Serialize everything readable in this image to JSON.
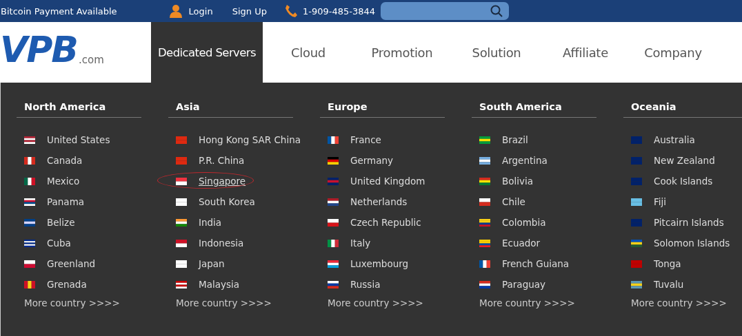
{
  "top_bar": {
    "notice": "Bitcoin Payment Available",
    "login": "Login",
    "signup": "Sign Up",
    "phone": "1-909-485-3844"
  },
  "logo": {
    "text": "VPB",
    "suffix": ".com"
  },
  "nav": [
    {
      "label": "Dedicated Servers",
      "selected": true
    },
    {
      "label": "Cloud",
      "selected": false
    },
    {
      "label": "Promotion",
      "selected": false
    },
    {
      "label": "Solution",
      "selected": false
    },
    {
      "label": "Affiliate",
      "selected": false
    },
    {
      "label": "Company",
      "selected": false
    }
  ],
  "regions": [
    {
      "title": "North America",
      "more": "More country >>>>",
      "countries": [
        {
          "name": "United States",
          "highlighted": false
        },
        {
          "name": "Canada",
          "highlighted": false
        },
        {
          "name": "Mexico",
          "highlighted": false
        },
        {
          "name": "Panama",
          "highlighted": false
        },
        {
          "name": "Belize",
          "highlighted": false
        },
        {
          "name": "Cuba",
          "highlighted": false
        },
        {
          "name": "Greenland",
          "highlighted": false
        },
        {
          "name": "Grenada",
          "highlighted": false
        }
      ]
    },
    {
      "title": "Asia",
      "more": "More country >>>>",
      "countries": [
        {
          "name": "Hong Kong SAR China",
          "highlighted": false
        },
        {
          "name": "P.R. China",
          "highlighted": false
        },
        {
          "name": "Singapore",
          "highlighted": true
        },
        {
          "name": "South Korea",
          "highlighted": false
        },
        {
          "name": "India",
          "highlighted": false
        },
        {
          "name": "Indonesia",
          "highlighted": false
        },
        {
          "name": "Japan",
          "highlighted": false
        },
        {
          "name": "Malaysia",
          "highlighted": false
        }
      ]
    },
    {
      "title": "Europe",
      "more": "More country >>>>",
      "countries": [
        {
          "name": "France",
          "highlighted": false
        },
        {
          "name": "Germany",
          "highlighted": false
        },
        {
          "name": "United Kingdom",
          "highlighted": false
        },
        {
          "name": "Netherlands",
          "highlighted": false
        },
        {
          "name": "Czech Republic",
          "highlighted": false
        },
        {
          "name": "Italy",
          "highlighted": false
        },
        {
          "name": "Luxembourg",
          "highlighted": false
        },
        {
          "name": "Russia",
          "highlighted": false
        }
      ]
    },
    {
      "title": "South America",
      "more": "More country >>>>",
      "countries": [
        {
          "name": "Brazil",
          "highlighted": false
        },
        {
          "name": "Argentina",
          "highlighted": false
        },
        {
          "name": "Bolivia",
          "highlighted": false
        },
        {
          "name": "Chile",
          "highlighted": false
        },
        {
          "name": "Colombia",
          "highlighted": false
        },
        {
          "name": "Ecuador",
          "highlighted": false
        },
        {
          "name": "French Guiana",
          "highlighted": false
        },
        {
          "name": "Paraguay",
          "highlighted": false
        }
      ]
    },
    {
      "title": "Oceania",
      "more": "More country >>>>",
      "countries": [
        {
          "name": "Australia",
          "highlighted": false
        },
        {
          "name": "New Zealand",
          "highlighted": false
        },
        {
          "name": "Cook Islands",
          "highlighted": false
        },
        {
          "name": "Fiji",
          "highlighted": false
        },
        {
          "name": "Pitcairn Islands",
          "highlighted": false
        },
        {
          "name": "Solomon Islands",
          "highlighted": false
        },
        {
          "name": "Tonga",
          "highlighted": false
        },
        {
          "name": "Tuvalu",
          "highlighted": false
        }
      ]
    }
  ]
}
